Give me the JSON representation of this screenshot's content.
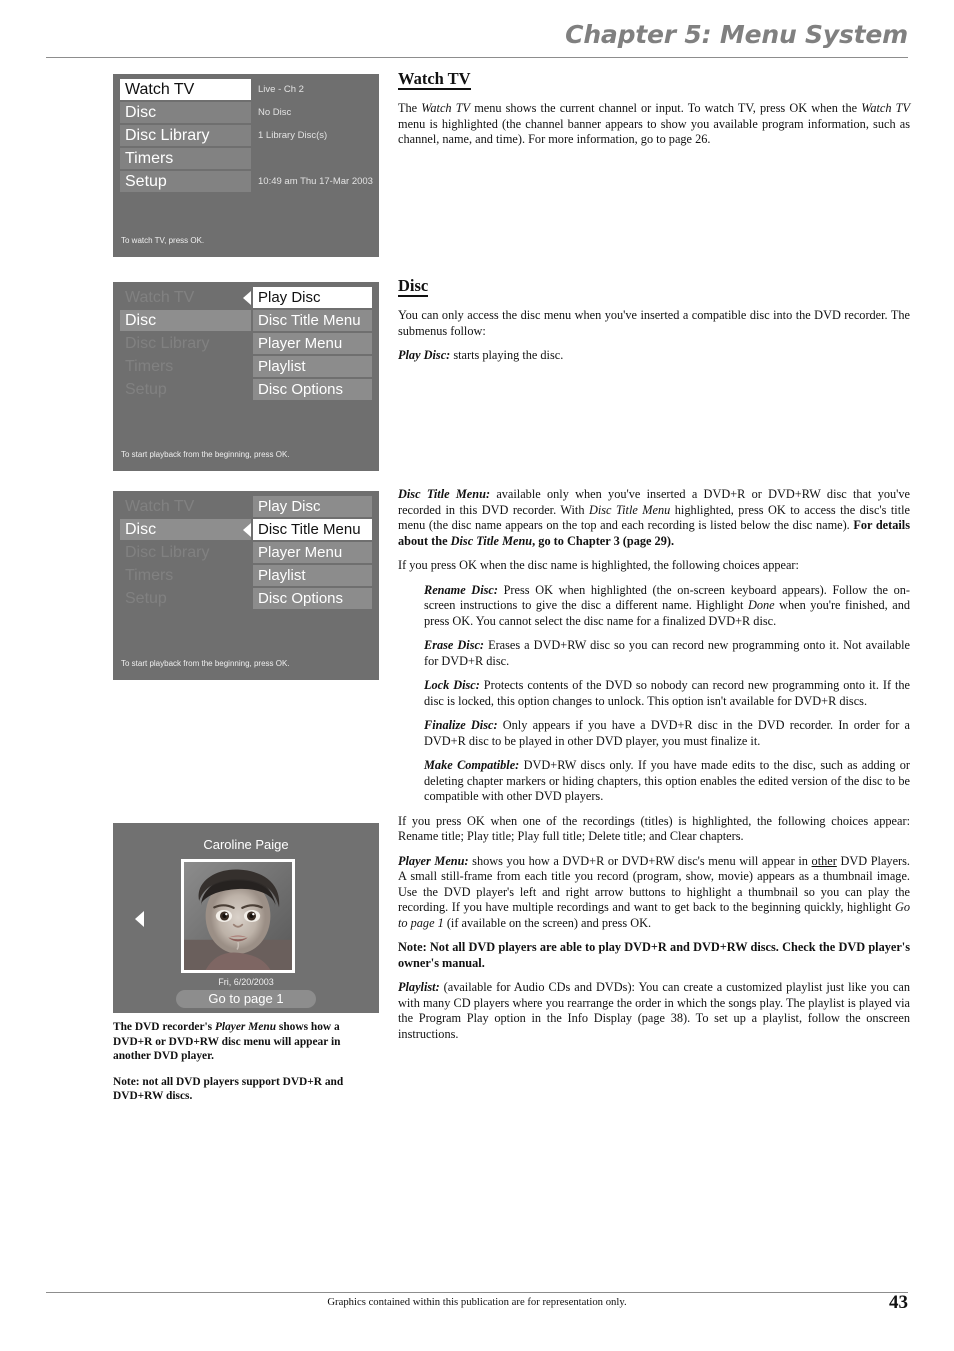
{
  "header": {
    "chapter_title": "Chapter 5: Menu System"
  },
  "osd_main_menu": {
    "items": [
      {
        "label": "Watch TV",
        "state": "selected"
      },
      {
        "label": "Disc",
        "state": "normal"
      },
      {
        "label": "Disc Library",
        "state": "normal"
      },
      {
        "label": "Timers",
        "state": "normal"
      },
      {
        "label": "Setup",
        "state": "normal"
      }
    ],
    "info": [
      "Live - Ch 2",
      "No Disc",
      "1 Library Disc(s)",
      "",
      "10:49 am Thu 17-Mar 2003"
    ],
    "hint": "To watch TV, press OK."
  },
  "osd_disc_play": {
    "items": [
      {
        "label": "Watch TV",
        "state": "dim"
      },
      {
        "label": "Disc",
        "state": "active-parent"
      },
      {
        "label": "Disc Library",
        "state": "dim"
      },
      {
        "label": "Timers",
        "state": "dim"
      },
      {
        "label": "Setup",
        "state": "dim"
      }
    ],
    "submenu": [
      {
        "label": "Play Disc",
        "state": "selected"
      },
      {
        "label": "Disc Title Menu",
        "state": "normal"
      },
      {
        "label": "Player Menu",
        "state": "normal"
      },
      {
        "label": "Playlist",
        "state": "normal"
      },
      {
        "label": "Disc Options",
        "state": "normal"
      }
    ],
    "selected_index": 0,
    "hint": "To start playback from the beginning, press OK."
  },
  "osd_disc_title": {
    "items": [
      {
        "label": "Watch TV",
        "state": "dim"
      },
      {
        "label": "Disc",
        "state": "active-parent"
      },
      {
        "label": "Disc Library",
        "state": "dim"
      },
      {
        "label": "Timers",
        "state": "dim"
      },
      {
        "label": "Setup",
        "state": "dim"
      }
    ],
    "submenu": [
      {
        "label": "Play Disc",
        "state": "normal"
      },
      {
        "label": "Disc Title Menu",
        "state": "selected"
      },
      {
        "label": "Player Menu",
        "state": "normal"
      },
      {
        "label": "Playlist",
        "state": "normal"
      },
      {
        "label": "Disc Options",
        "state": "normal"
      }
    ],
    "selected_index": 1,
    "hint": "To start playback from the beginning, press OK."
  },
  "osd_player_menu": {
    "title": "Caroline Paige",
    "date": "Fri, 6/20/2003",
    "goto_button": "Go to page 1"
  },
  "caption": {
    "line1_prefix": "The DVD recorder's ",
    "line1_italic": "Player Menu",
    "line1_suffix": " shows how a DVD+R or DVD+RW disc menu will appear in another DVD player.",
    "line2": "Note: not all DVD players support DVD+R and DVD+RW discs."
  },
  "sections": {
    "watch_tv": {
      "heading": "Watch TV",
      "p1_a": "The ",
      "p1_i1": "Watch TV",
      "p1_b": " menu shows the current channel or input. To watch TV, press OK when the ",
      "p1_i2": "Watch TV",
      "p1_c": " menu is highlighted (the channel banner appears to show you available program information, such as channel, name, and time). For more information, go to page 26."
    },
    "disc": {
      "heading": "Disc",
      "p1": "You can only access the disc menu when you've inserted a compatible disc into the DVD recorder. The submenus follow:",
      "p2_term": "Play Disc:",
      "p2_text": " starts playing the disc."
    },
    "disc_title_menu": {
      "p1_term": "Disc Title Menu:",
      "p1_a": " available only when you've inserted a DVD+R or DVD+RW disc that you've recorded in this DVD recorder. With ",
      "p1_i": "Disc Title Menu",
      "p1_b": " highlighted, press OK to access the disc's title menu (the disc name appears on the top and each recording is listed below the disc name). ",
      "p1_bold_a": "For details about the ",
      "p1_bold_i": "Disc Title Menu",
      "p1_bold_b": ", go to Chapter 3 (page 29).",
      "p2": "If you press OK when the disc name is highlighted, the following choices appear:",
      "rename_term": "Rename Disc:",
      "rename_a": " Press OK when highlighted (the on-screen keyboard appears). Follow the on-screen instructions to give the disc a different name. Highlight ",
      "rename_i": "Done",
      "rename_b": " when you're finished, and press OK. You cannot select the disc name for a finalized DVD+R disc.",
      "erase_term": "Erase Disc:",
      "erase_text": " Erases a DVD+RW disc so you can record new programming onto it. Not available for DVD+R disc.",
      "lock_term": "Lock Disc:",
      "lock_text": " Protects contents of the DVD so nobody can record new programming onto it. If the disc is locked, this option changes to unlock. This option isn't available for DVD+R discs.",
      "finalize_term": "Finalize Disc:",
      "finalize_text": " Only appears if you have a DVD+R disc in the DVD recorder. In order for a DVD+R disc to be played in other DVD player, you must finalize it.",
      "compatible_term": "Make Compatible:",
      "compatible_text": " DVD+RW discs only. If you have made edits to the disc, such as adding or deleting chapter markers or hiding chapters, this option enables the edited version of the disc to be compatible with other DVD players.",
      "titles_p": "If you press OK when one of the recordings (titles) is highlighted, the following choices appear: Rename title; Play title; Play full title; Delete title; and Clear chapters.",
      "player_term": "Player Menu:",
      "player_a": " shows you how a DVD+R or DVD+RW disc's menu will appear in ",
      "player_u": "other",
      "player_b": " DVD Players. A small still-frame from each title you record (program, show, movie) appears as a thumbnail image. Use the DVD player's left and right arrow buttons to highlight a thumbnail so you can play the recording. If you have multiple recordings and want to get back to the beginning quickly, highlight ",
      "player_i": "Go to page 1",
      "player_c": " (if available on the screen) and press OK.",
      "note_bold": "Note: Not all DVD players are able to play DVD+R and DVD+RW discs. Check the DVD player's owner's manual.",
      "playlist_term": "Playlist:",
      "playlist_text": " (available for Audio CDs and DVDs): You can create a customized playlist just like you can with many CD players where you rearrange the order in which the songs play. The playlist is played via the Program Play option in the Info Display (page 38). To set up a playlist, follow the onscreen instructions."
    }
  },
  "footer": {
    "note": "Graphics contained within this publication are for representation only.",
    "page_number": "43"
  },
  "colors": {
    "osd_background": "#6f6f6f",
    "osd_item": "#828282",
    "osd_item_selected": "#ffffff",
    "chapter_title": "#808080",
    "rule": "#8d8d8d"
  }
}
